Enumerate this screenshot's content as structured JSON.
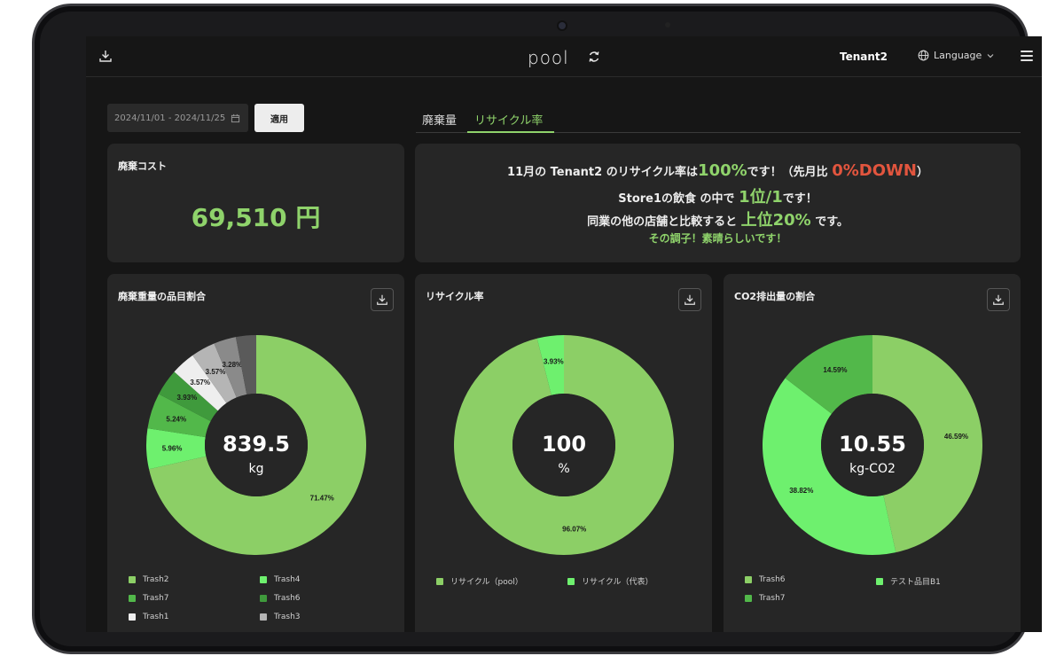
{
  "header": {
    "logo_text": "pool",
    "tenant": "Tenant2",
    "language_label": "Language"
  },
  "filters": {
    "date_range": "2024/11/01 - 2024/11/25",
    "apply_label": "適用"
  },
  "tabs": [
    {
      "label": "廃棄量",
      "active": false
    },
    {
      "label": "リサイクル率",
      "active": true
    }
  ],
  "cost_card": {
    "title": "廃棄コスト",
    "value": "69,510 円"
  },
  "message": {
    "l1_a": "11月の Tenant2 のリサイクル率は",
    "l1_rate": "100%",
    "l1_b": "です！（先月比",
    "l1_change": "0%DOWN",
    "l1_c": "）",
    "l2_a": "Store1の飲食 の中で",
    "l2_rank": "1位/1",
    "l2_b": "です！",
    "l3_a": "同業の他の店舗と比較すると",
    "l3_rank": "上位20%",
    "l3_b": "です。",
    "l4": "その調子！素晴らしいです！"
  },
  "colors": {
    "accent": "#8fd36b",
    "down": "#e2553e",
    "bg": "#161616",
    "card": "#262626"
  },
  "charts": [
    {
      "title": "廃棄重量の品目割合",
      "center_value": "839.5",
      "center_unit": "kg",
      "chart_data": {
        "type": "pie",
        "slices": [
          {
            "label": "Trash2",
            "value": 71.47,
            "color": "#8ccf66",
            "pct_label": "71.47%"
          },
          {
            "label": "Trash4",
            "value": 5.96,
            "color": "#6ef06e",
            "pct_label": "5.96%"
          },
          {
            "label": "Trash7",
            "value": 5.24,
            "color": "#52b84a",
            "pct_label": "5.24%"
          },
          {
            "label": "Trash6",
            "value": 3.93,
            "color": "#3f9a3c",
            "pct_label": "3.93%"
          },
          {
            "label": "Trash1",
            "value": 3.57,
            "color": "#eeeeee",
            "pct_label": "3.57%"
          },
          {
            "label": "Trash3",
            "value": 3.57,
            "color": "#b5b5b5",
            "pct_label": "3.57%"
          },
          {
            "label": "",
            "value": 3.28,
            "color": "#8a8a8a",
            "pct_label": "3.28%"
          },
          {
            "label": "",
            "value": 2.98,
            "color": "#5a5a5a",
            "pct_label": ""
          }
        ]
      },
      "legend": [
        "Trash2",
        "Trash4",
        "Trash7",
        "Trash6",
        "Trash1",
        "Trash3"
      ],
      "legend_colors": [
        "#8ccf66",
        "#6ef06e",
        "#52b84a",
        "#3f9a3c",
        "#eeeeee",
        "#b5b5b5"
      ]
    },
    {
      "title": "リサイクル率",
      "center_value": "100",
      "center_unit": "%",
      "chart_data": {
        "type": "pie",
        "slices": [
          {
            "label": "リサイクル（pool）",
            "value": 96.07,
            "color": "#8ccf66",
            "pct_label": "96.07%"
          },
          {
            "label": "リサイクル（代表）",
            "value": 3.93,
            "color": "#6ef06e",
            "pct_label": "3.93%"
          }
        ]
      },
      "legend": [
        "リサイクル（pool）",
        "リサイクル（代表）"
      ],
      "legend_colors": [
        "#8ccf66",
        "#6ef06e"
      ]
    },
    {
      "title": "CO2排出量の割合",
      "center_value": "10.55",
      "center_unit": "kg-CO2",
      "chart_data": {
        "type": "pie",
        "slices": [
          {
            "label": "Trash6",
            "value": 46.59,
            "color": "#8ccf66",
            "pct_label": "46.59%"
          },
          {
            "label": "テスト品目B1",
            "value": 38.82,
            "color": "#6ef06e",
            "pct_label": "38.82%"
          },
          {
            "label": "Trash7",
            "value": 14.59,
            "color": "#52b84a",
            "pct_label": "14.59%"
          }
        ]
      },
      "legend": [
        "Trash6",
        "テスト品目B1",
        "Trash7"
      ],
      "legend_colors": [
        "#8ccf66",
        "#6ef06e",
        "#52b84a"
      ]
    }
  ]
}
